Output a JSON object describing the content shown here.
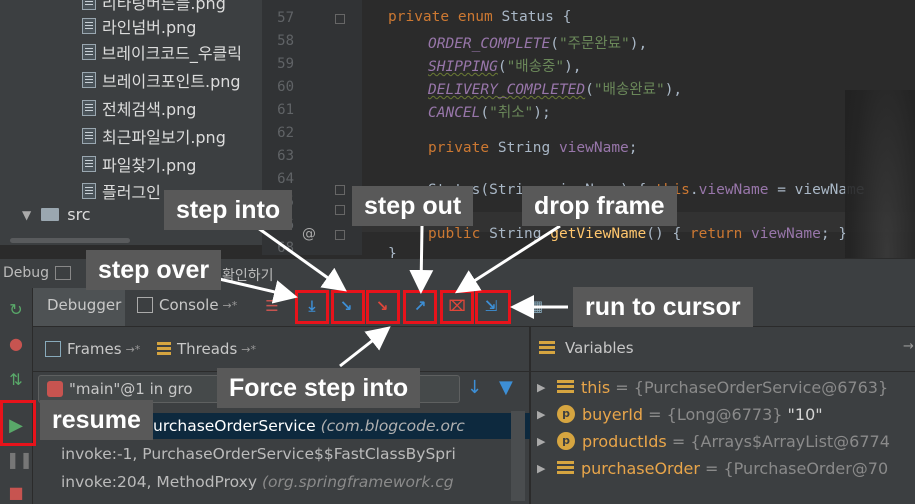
{
  "project_tree": {
    "files": [
      "리타링버튼들.png",
      "라인넘버.png",
      "브레이크코드_우클릭",
      "브레이크포인트.png",
      "전체검색.png",
      "최근파일보기.png",
      "파일찾기.png",
      "플러그인"
    ],
    "folder": "src"
  },
  "editor": {
    "line_numbers": [
      "57",
      "58",
      "59",
      "60",
      "61",
      "62",
      "63",
      "64",
      "65",
      "66",
      "68"
    ],
    "code": {
      "l57": {
        "kw": "private enum",
        "rest": " Status {"
      },
      "l58": {
        "name": "ORDER_COMPLETE",
        "arg": "\"주문완료\"",
        "tail": "),"
      },
      "l59": {
        "name": "SHIPPING",
        "arg": "\"배송중\"",
        "tail": "),"
      },
      "l60": {
        "name": "DELIVERY_COMPLETED",
        "arg": "\"배송완료\"",
        "tail": "),"
      },
      "l61": {
        "name": "CANCEL",
        "arg": "\"취소\"",
        "tail": ");"
      },
      "l63": {
        "kw": "private",
        "type": " String ",
        "field": "viewName",
        "tail": ";"
      },
      "l65": {
        "pre": "Status(String viewName) { ",
        "kw": "this",
        "dot": ".",
        "field": "viewName",
        "tail": " = viewName"
      },
      "l66": {
        "kw": "public",
        "type": " String ",
        "fn": "getViewName",
        "mid": "() { ",
        "kw2": "return",
        "field": " viewName",
        "tail": "; }"
      },
      "l68": {
        "text": "}"
      }
    }
  },
  "debug_bar": {
    "title": "Debug",
    "tab_hidden": "확인하기"
  },
  "toolbar": {
    "debugger_tab": "Debugger",
    "console_tab": "Console",
    "pin": "→*"
  },
  "frames_panel": {
    "frames_tab": "Frames",
    "threads_tab": "Threads",
    "pin": "→*",
    "thread_select": "\"main\"@1 in gro",
    "rows": [
      {
        "method": "urchaseOrderService",
        "pkg": "(com.blogcode.orc"
      },
      {
        "method": "invoke:-1, PurchaseOrderService$$FastClassBySpri",
        "pkg": ""
      },
      {
        "method": "invoke:204, MethodProxy",
        "pkg": "(org.springframework.cg"
      }
    ]
  },
  "variables_panel": {
    "title": "Variables",
    "rows": [
      {
        "name": "this",
        "type": "{PurchaseOrderService@6763}",
        "value": ""
      },
      {
        "name": "buyerId",
        "type": "{Long@6773}",
        "value": "\"10\""
      },
      {
        "name": "productIds",
        "type": "{Arrays$ArrayList@6774",
        "value": ""
      },
      {
        "name": "purchaseOrder",
        "type": "{PurchaseOrder@70",
        "value": ""
      }
    ]
  },
  "callouts": {
    "step_into": "step into",
    "step_out": "step out",
    "drop_frame": "drop frame",
    "step_over": "step over",
    "run_to_cursor": "run to cursor",
    "force_step_into": "Force step into",
    "resume": "resume"
  },
  "colors": {
    "accent_red": "#e8131b",
    "callout_bg": "#595959",
    "step_blue": "#3d8fd6",
    "step_red": "#e0463a"
  }
}
